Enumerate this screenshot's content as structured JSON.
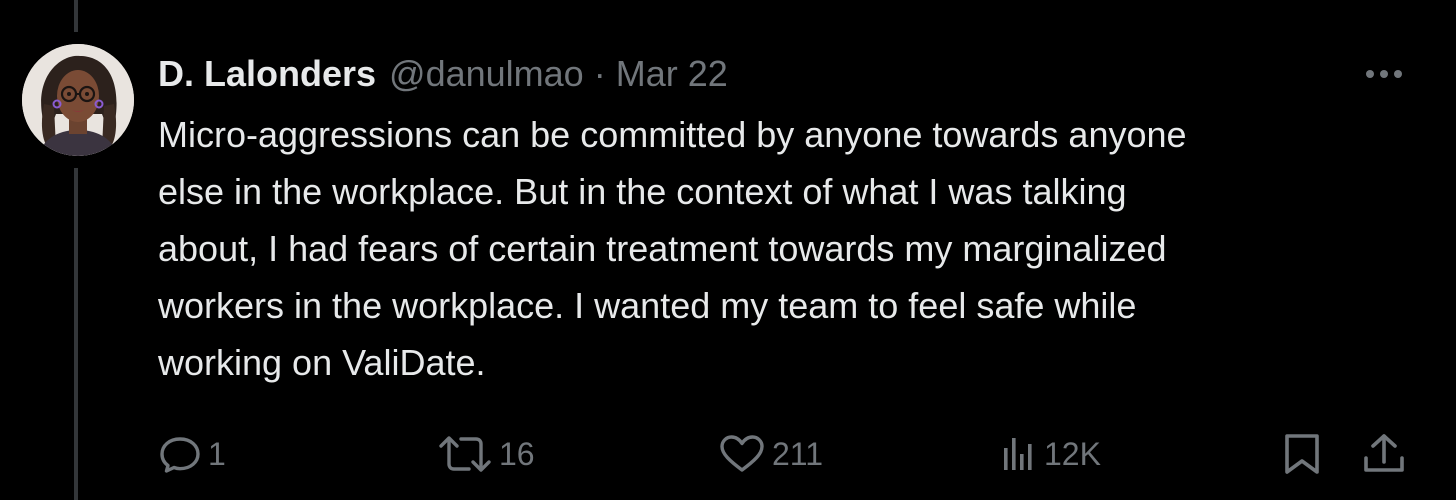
{
  "tweet": {
    "author": {
      "display_name": "D. Lalonders",
      "handle": "@danulmao"
    },
    "separator": "·",
    "date": "Mar 22",
    "text": "Micro-aggressions can be committed by anyone towards anyone\nelse in the workplace. But in the context of what I was talking\nabout, I had fears of certain treatment towards my marginalized\nworkers in the workplace. I wanted my team to feel safe while\nworking on ValiDate.",
    "stats": {
      "replies": "1",
      "retweets": "16",
      "likes": "211",
      "views": "12K"
    }
  },
  "icons": {
    "more": "more-horizontal-icon",
    "reply": "reply-icon",
    "retweet": "retweet-icon",
    "like": "heart-icon",
    "views": "views-icon",
    "bookmark": "bookmark-icon",
    "share": "share-icon"
  },
  "colors": {
    "background": "#000000",
    "primary_text": "#e7e9ea",
    "secondary_text": "#71767b",
    "thread_line": "#333639"
  }
}
